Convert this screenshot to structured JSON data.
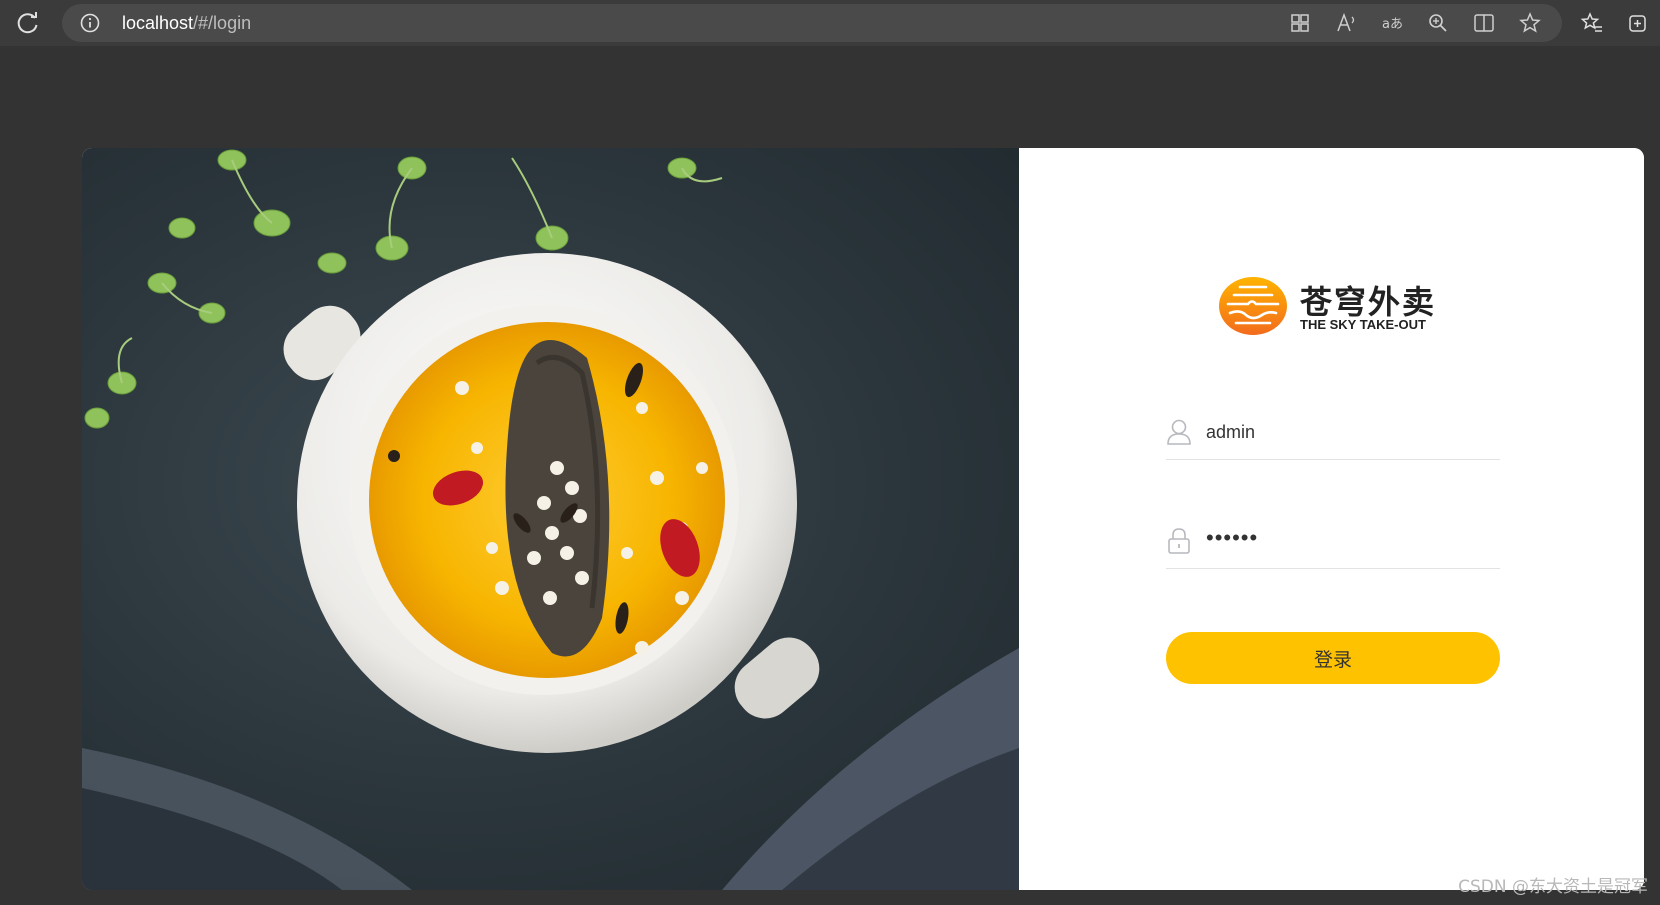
{
  "browser": {
    "url_host": "localhost",
    "url_path": "/#/login",
    "icons": [
      "reload-icon",
      "info-icon",
      "app-grid-icon",
      "read-aloud-icon",
      "translate-icon",
      "zoom-icon",
      "split-screen-icon",
      "favorite-star-icon",
      "favorites-icon",
      "collections-icon"
    ]
  },
  "logo": {
    "name_cn": "苍穹外卖",
    "name_en": "THE SKY TAKE-OUT"
  },
  "form": {
    "username_value": "admin",
    "password_masked": "••••••",
    "login_label": "登录"
  },
  "colors": {
    "accent": "#ffc200",
    "background": "#333333"
  },
  "watermark": "CSDN @东大资土是冠军"
}
